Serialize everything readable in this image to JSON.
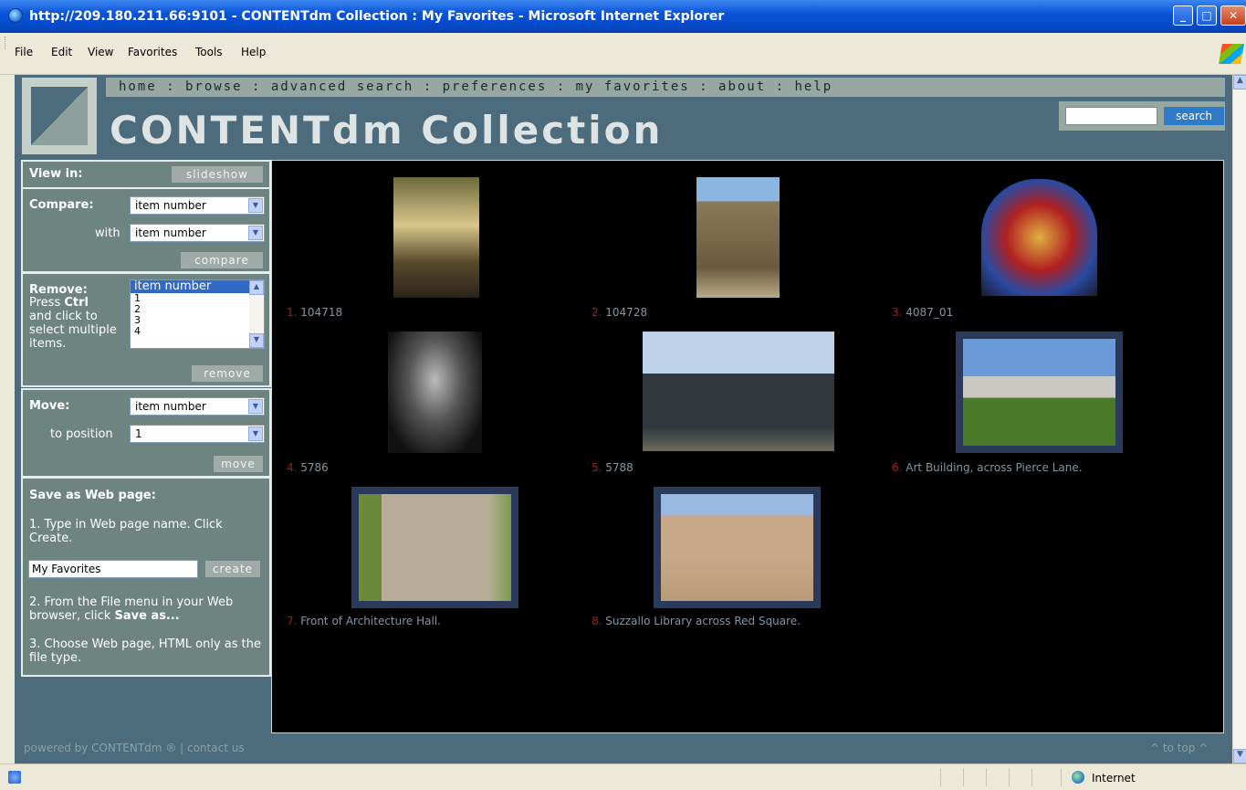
{
  "window": {
    "title": "http://209.180.211.66:9101 - CONTENTdm Collection : My Favorites - Microsoft Internet Explorer",
    "minimize": "_",
    "maximize": "□",
    "close": "✕"
  },
  "menu": [
    "File",
    "Edit",
    "View",
    "Favorites",
    "Tools",
    "Help"
  ],
  "nav": "home : browse : advanced search : preferences : my favorites : about : help",
  "site_title": "CONTENTdm Collection",
  "search": {
    "button": "search",
    "value": ""
  },
  "panel": {
    "view_in": {
      "label": "View in:",
      "button": "slideshow"
    },
    "compare": {
      "label": "Compare:",
      "select1": "item number",
      "with_label": "with",
      "select2": "item number",
      "button": "compare"
    },
    "remove": {
      "label": "Remove:",
      "help_pre": "Press ",
      "help_bold": "Ctrl",
      "help_post": "and click to select multiple items.",
      "items": [
        "item number",
        "1",
        "2",
        "3",
        "4"
      ],
      "button": "remove"
    },
    "move": {
      "label": "Move:",
      "select": "item number",
      "to_label": "to position",
      "position": "1",
      "button": "move"
    },
    "save": {
      "label": "Save as Web page:",
      "step1": "1. Type in Web page name. Click Create.",
      "name_value": "My Favorites",
      "create": "create",
      "step2_pre": "2. From the File menu in your Web browser, click ",
      "step2_bold": "Save as...",
      "step3": "3. Choose Web page, HTML only as the file type."
    }
  },
  "items": [
    {
      "num": "1.",
      "title": "104718"
    },
    {
      "num": "2.",
      "title": "104728"
    },
    {
      "num": "3.",
      "title": "4087_01"
    },
    {
      "num": "4.",
      "title": "5786"
    },
    {
      "num": "5.",
      "title": "5788"
    },
    {
      "num": "6.",
      "title": "Art Building, across Pierce Lane."
    },
    {
      "num": "7.",
      "title": "Front of Architecture Hall."
    },
    {
      "num": "8.",
      "title": "Suzzallo Library across Red Square."
    }
  ],
  "footer": {
    "powered": "powered by CONTENTdm ® | contact us",
    "top": "^ to top ^"
  },
  "status": {
    "zone": "Internet"
  },
  "colors": {
    "panel_bg": "#6e8481",
    "page_bg": "#4c6c7d",
    "gallery_bg": "#000000",
    "number_red": "#b01818"
  }
}
